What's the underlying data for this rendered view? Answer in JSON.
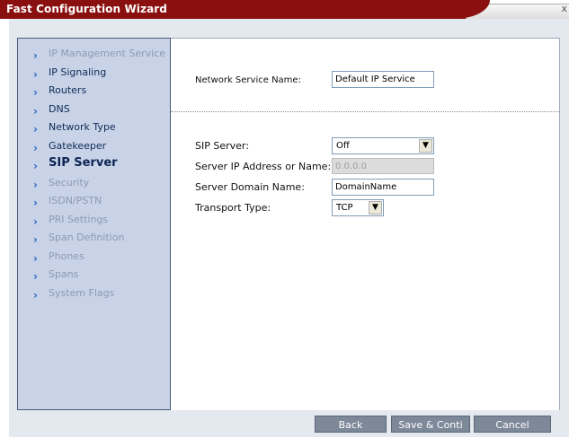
{
  "window": {
    "title": "Fast Configuration Wizard",
    "close_glyph": "x"
  },
  "sidebar": {
    "items": [
      {
        "label": "IP Management Service",
        "state": "disabled"
      },
      {
        "label": "IP Signaling",
        "state": "active"
      },
      {
        "label": "Routers",
        "state": "active"
      },
      {
        "label": "DNS",
        "state": "active"
      },
      {
        "label": "Network Type",
        "state": "active"
      },
      {
        "label": "Gatekeeper",
        "state": "active"
      },
      {
        "label": "SIP Server",
        "state": "current"
      },
      {
        "label": "Security",
        "state": "disabled"
      },
      {
        "label": "ISDN/PSTN",
        "state": "disabled"
      },
      {
        "label": "PRI Settings",
        "state": "disabled"
      },
      {
        "label": "Span Definition",
        "state": "disabled"
      },
      {
        "label": "Phones",
        "state": "disabled"
      },
      {
        "label": "Spans",
        "state": "disabled"
      },
      {
        "label": "System Flags",
        "state": "active"
      }
    ]
  },
  "form": {
    "network_service_name": {
      "label": "Network Service Name:",
      "value": "Default IP Service"
    },
    "sip_server": {
      "label": "SIP Server:",
      "value": "Off"
    },
    "server_ip": {
      "label": "Server IP Address or Name:",
      "value": "0.0.0.0"
    },
    "server_domain": {
      "label": "Server Domain Name:",
      "value": "DomainName"
    },
    "transport_type": {
      "label": "Transport Type:",
      "value": "TCP"
    }
  },
  "buttons": {
    "back": "Back",
    "save": "Save & Conti",
    "cancel": "Cancel"
  },
  "icons": {
    "chevron": "chevron-right-icon",
    "dropdown": "chevron-down-icon"
  },
  "colors": {
    "title_bar": "#8a1010",
    "sidebar_bg": "#c8d3e8",
    "button_bg": "#7d8899",
    "chevron": "#2d6bbd"
  }
}
